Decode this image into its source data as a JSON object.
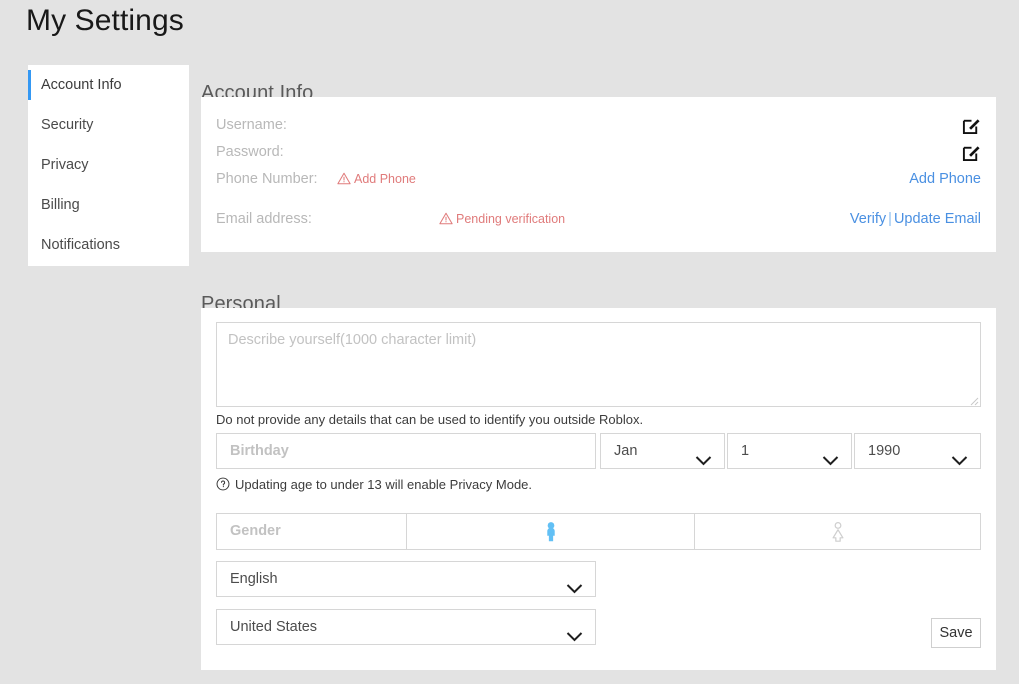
{
  "page": {
    "title": "My Settings",
    "accent_color": "#3498f3",
    "link_color": "#4a90e2",
    "warning_color": "#e07b7b",
    "background": "#e3e3e3"
  },
  "sidebar": {
    "items": [
      {
        "label": "Account Info",
        "active": true
      },
      {
        "label": "Security",
        "active": false
      },
      {
        "label": "Privacy",
        "active": false
      },
      {
        "label": "Billing",
        "active": false
      },
      {
        "label": "Notifications",
        "active": false
      }
    ]
  },
  "account_info": {
    "heading": "Account Info",
    "rows": {
      "username": {
        "label": "Username:",
        "action_icon": "edit-icon"
      },
      "password": {
        "label": "Password:",
        "action_icon": "edit-icon"
      },
      "phone": {
        "label": "Phone Number:",
        "status_icon": "warning-triangle-icon",
        "status": "Add Phone",
        "action": "Add Phone"
      },
      "email": {
        "label": "Email address:",
        "status_icon": "warning-triangle-icon",
        "status": "Pending verification",
        "action_verify": "Verify",
        "action_separator": "|",
        "action_update": "Update Email"
      }
    }
  },
  "personal": {
    "heading": "Personal",
    "bio_placeholder": "Describe yourself(1000 character limit)",
    "bio_note": "Do not provide any details that can be used to identify you outside Roblox.",
    "birthday_placeholder": "Birthday",
    "birth_month": "Jan",
    "birth_day": "1",
    "birth_year": "1990",
    "age_note_icon": "question-circle-icon",
    "age_note": "Updating age to under 13 will enable Privacy Mode.",
    "gender_placeholder": "Gender",
    "gender_male_icon": "male-figure-icon",
    "gender_female_icon": "female-figure-icon",
    "gender_selected": "male",
    "language": "English",
    "country": "United States",
    "save_label": "Save"
  }
}
